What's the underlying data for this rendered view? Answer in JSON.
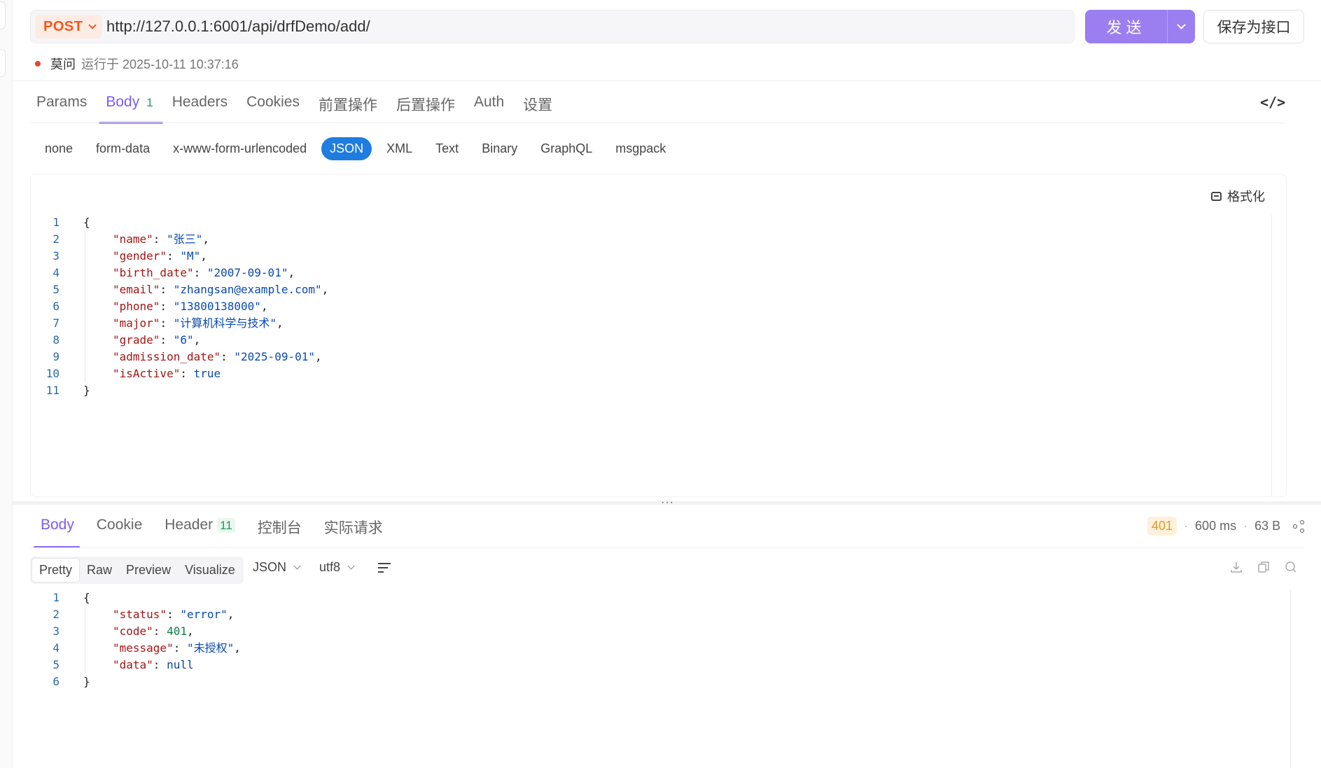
{
  "request": {
    "method": "POST",
    "url": "http://127.0.0.1:6001/api/drfDemo/add/",
    "send_label": "发送",
    "save_label": "保存为接口",
    "run_user": "莫问",
    "run_text": "运行于 2025-10-11 10:37:16"
  },
  "req_tabs": [
    {
      "label": "Params"
    },
    {
      "label": "Body",
      "badge": "1"
    },
    {
      "label": "Headers"
    },
    {
      "label": "Cookies"
    },
    {
      "label": "前置操作"
    },
    {
      "label": "后置操作"
    },
    {
      "label": "Auth"
    },
    {
      "label": "设置"
    }
  ],
  "code_toggle_label": "</>",
  "body_types": [
    "none",
    "form-data",
    "x-www-form-urlencoded",
    "JSON",
    "XML",
    "Text",
    "Binary",
    "GraphQL",
    "msgpack"
  ],
  "format_label": "格式化",
  "request_body": {
    "fields": [
      {
        "key": "\"name\"",
        "value": "\"张三\"",
        "type": "s"
      },
      {
        "key": "\"gender\"",
        "value": "\"M\"",
        "type": "s"
      },
      {
        "key": "\"birth_date\"",
        "value": "\"2007-09-01\"",
        "type": "s"
      },
      {
        "key": "\"email\"",
        "value": "\"zhangsan@example.com\"",
        "type": "s"
      },
      {
        "key": "\"phone\"",
        "value": "\"13800138000\"",
        "type": "s"
      },
      {
        "key": "\"major\"",
        "value": "\"计算机科学与技术\"",
        "type": "s"
      },
      {
        "key": "\"grade\"",
        "value": "\"6\"",
        "type": "s"
      },
      {
        "key": "\"admission_date\"",
        "value": "\"2025-09-01\"",
        "type": "s"
      },
      {
        "key": "\"isActive\"",
        "value": "true",
        "type": "b"
      }
    ]
  },
  "resize_dots": "···",
  "resp_tabs": [
    {
      "label": "Body"
    },
    {
      "label": "Cookie"
    },
    {
      "label": "Header",
      "badge": "11"
    },
    {
      "label": "控制台"
    },
    {
      "label": "实际请求"
    }
  ],
  "resp_meta": {
    "status": "401",
    "time": "600 ms",
    "size": "63 B"
  },
  "view_modes": [
    "Pretty",
    "Raw",
    "Preview",
    "Visualize"
  ],
  "format_select": "JSON",
  "encoding_select": "utf8",
  "response_body": {
    "fields": [
      {
        "key": "\"status\"",
        "value": "\"error\"",
        "type": "s"
      },
      {
        "key": "\"code\"",
        "value": "401",
        "type": "n"
      },
      {
        "key": "\"message\"",
        "value": "\"未授权\"",
        "type": "s"
      },
      {
        "key": "\"data\"",
        "value": "null",
        "type": "b"
      }
    ]
  },
  "icons": [
    "chevron-down-icon",
    "code-icon",
    "format-icon",
    "share-icon",
    "wrap-icon",
    "download-icon",
    "copy-icon",
    "search-icon"
  ],
  "colors": {
    "accent": "#7d5cf0",
    "send": "#9b7ef0",
    "method": "#f2571b",
    "json_active": "#1f7ce0",
    "status_warn": "#e49a22"
  }
}
